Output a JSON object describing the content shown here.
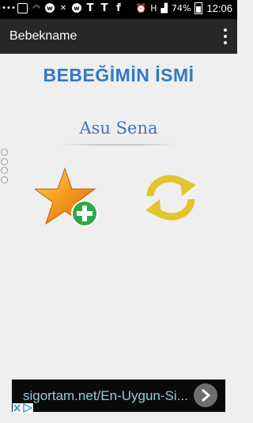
{
  "status_bar": {
    "battery": "74%",
    "time": "12:06",
    "network": "H"
  },
  "app_bar": {
    "title": "Bebekname"
  },
  "main": {
    "heading": "BEBEĞİMİN İSMİ",
    "baby_name": "Asu Sena"
  },
  "actions": {
    "add_favorite_icon": "star-plus-icon",
    "refresh_icon": "refresh-icon"
  },
  "ad": {
    "text": "sigortam.net/En-Uygun-Si..."
  },
  "colors": {
    "heading": "#2f7ac6",
    "name": "#3e75c2",
    "app_bar": "#272727",
    "star": "#f28a1c",
    "plus": "#2fa84a",
    "refresh": "#e0c52b"
  }
}
